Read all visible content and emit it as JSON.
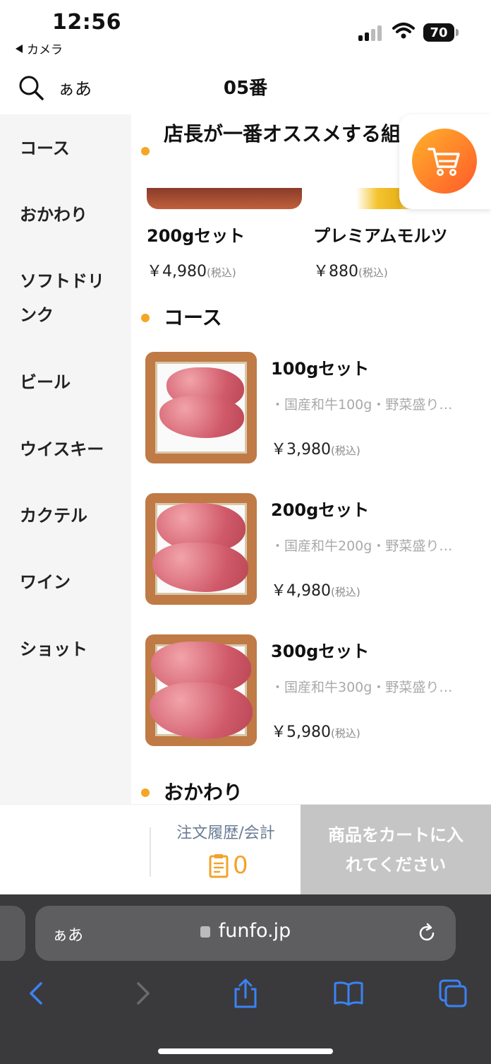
{
  "status_bar": {
    "time": "12:56",
    "back_app": "カメラ",
    "battery": "70"
  },
  "header": {
    "font_size_button": "ぁあ",
    "title": "05番"
  },
  "sidebar": {
    "items": [
      {
        "label": "コース"
      },
      {
        "label": "おかわり"
      },
      {
        "label": "ソフトドリンク"
      },
      {
        "label": "ビール"
      },
      {
        "label": "ウイスキー"
      },
      {
        "label": "カクテル"
      },
      {
        "label": "ワイン"
      },
      {
        "label": "ショット"
      }
    ]
  },
  "recommend": {
    "title": "店長が一番オススメする組せ",
    "items": [
      {
        "name": "200gセット",
        "price": "￥4,980",
        "tax": "(税込)"
      },
      {
        "name": "プレミアムモルツ",
        "price": "￥880",
        "tax": "(税込)"
      }
    ]
  },
  "sections": [
    {
      "title": "コース"
    },
    {
      "title": "おかわり"
    }
  ],
  "course_items": [
    {
      "name": "100gセット",
      "desc": "・国産和牛100g・野菜盛り…",
      "price": "￥3,980",
      "tax": "(税込)"
    },
    {
      "name": "200gセット",
      "desc": "・国産和牛200g・野菜盛り…",
      "price": "￥4,980",
      "tax": "(税込)"
    },
    {
      "name": "300gセット",
      "desc": "・国産和牛300g・野菜盛り…",
      "price": "￥5,980",
      "tax": "(税込)"
    }
  ],
  "order_bar": {
    "history_label": "注文履歴/会計",
    "history_count": "0",
    "add_to_cart": "商品をカートに入れてください"
  },
  "browser": {
    "aa": "ぁあ",
    "host": "funfo.jp"
  },
  "icons": {
    "search": "search-icon",
    "cart": "cart-icon",
    "clipboard": "clipboard-icon",
    "lock": "lock-icon",
    "reload": "reload-icon",
    "back": "chevron-left-icon",
    "forward": "chevron-right-icon",
    "share": "share-icon",
    "bookmarks": "book-icon",
    "tabs": "tabs-icon"
  },
  "colors": {
    "accent": "#f5a623",
    "cart_gradient_start": "#ffb12b",
    "cart_gradient_end": "#ff5a2a",
    "button_disabled": "#c5c5c5",
    "browser_bar": "#3a3a3c",
    "safari_blue": "#3b82f6"
  }
}
